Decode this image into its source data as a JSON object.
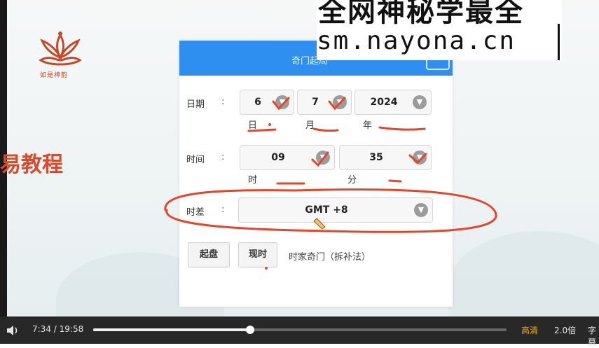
{
  "brand": {
    "logo_text": "如是神韵"
  },
  "side_title": "易教程",
  "watermark": {
    "line1": "全网神秘学最全",
    "line2": "sm.nayona.cn"
  },
  "panel": {
    "title": "奇门起局",
    "date": {
      "label": "日期",
      "colon": ":",
      "day": "6",
      "month": "7",
      "year": "2024",
      "unit_day": "日",
      "unit_month": "月",
      "unit_year": "年"
    },
    "time": {
      "label": "时间",
      "colon": ":",
      "hour": "09",
      "minute": "35",
      "unit_hour": "时",
      "unit_minute": "分"
    },
    "offset": {
      "label": "时差",
      "colon": ":",
      "value": "GMT +8"
    },
    "buttons": {
      "start": "起盘",
      "now": "现时"
    },
    "method_note": "时家奇门（拆补法）"
  },
  "player": {
    "current": "7:34",
    "separator": "/",
    "duration": "19:58",
    "progress": 0.379,
    "quality": "高清",
    "speed": "2.0倍",
    "subtitle": "字幕"
  },
  "colors": {
    "header": "#2f8ff0",
    "annotation": "#e6452a",
    "quality": "#f0a500"
  }
}
